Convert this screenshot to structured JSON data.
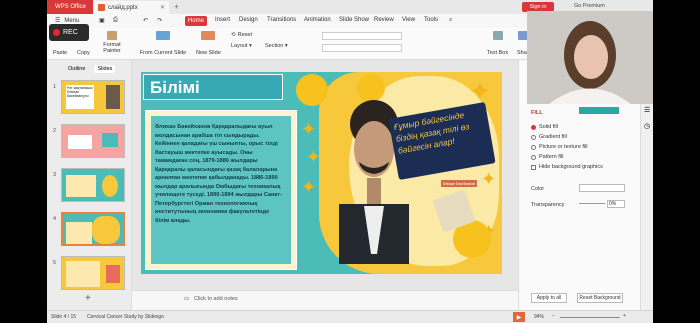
{
  "titlebar": {
    "app_tab": "WPS Office",
    "file_tab": "слайд.pptx",
    "signin": "Sign in",
    "premium": "Go Premium"
  },
  "menubar": {
    "menu": "Menu",
    "items": [
      "Home",
      "Insert",
      "Design",
      "Transitions",
      "Animation",
      "Slide Show",
      "Review",
      "View",
      "Tools"
    ],
    "active": "Home"
  },
  "toolbar": {
    "rec": "REC",
    "paste": "Paste",
    "copy": "Copy",
    "format_painter": "Format Painter",
    "from_current": "From Current Slide",
    "new_slide": "New Slide",
    "reset": "Reset",
    "layout": "Layout",
    "section": "Section",
    "text_box": "Text Box",
    "shapes": "Shap"
  },
  "leftpanel": {
    "tabs": [
      "Outline",
      "Slides"
    ],
    "active_tab": "Slides",
    "slides": [
      {
        "num": "1",
        "title": "Ұлт мақтанышы Әлихан Бөкейханұлы"
      },
      {
        "num": "2"
      },
      {
        "num": "3"
      },
      {
        "num": "4"
      },
      {
        "num": "5"
      }
    ],
    "selected": 4
  },
  "slide": {
    "title": "Білімі",
    "body": "Әлихан Бөкейханов Қарқаралыдағы ауыл молдасынан арабша тіл сындырады. Кейіннен қаладағы үш сыныпты, орыс тілді бастауыш мектепке ауысады. Оны тамамдаған соң, 1879-1886 жылдары Қарқаралы қалаcындағы қазақ балаларына арналған мектепке қабылданады. 1886-1890 жылдар аралығында Омбыдағы техникалық училищеге түседі. 1890-1894 жылдары Санкт-Петербургтегі Орман технологиялық институтының экономика факультетінде білім алады.",
    "quote": "Ғұмыр бәйгесінде біздің қазақ тілі өз бәйгесін алар!",
    "quote_author": "Әлихан Бөкейханов"
  },
  "rightpanel": {
    "fill_label": "FILL",
    "options": [
      "Solid fill",
      "Gradient fill",
      "Picture or texture fill",
      "Pattern fill"
    ],
    "selected_option": "Solid fill",
    "hide_bg": "Hide background graphics",
    "color_label": "Color",
    "transparency_label": "Transparency",
    "transparency_value": "0%",
    "apply_all": "Apply to all",
    "reset_bg": "Reset Background",
    "fill_color": "#2aa9a4"
  },
  "notes": {
    "placeholder": "Click to add notes"
  },
  "statusbar": {
    "slide_info": "Slide 4 / 15",
    "theme": "Cervical Cancer Study by Slidesgo",
    "zoom": "94%"
  }
}
